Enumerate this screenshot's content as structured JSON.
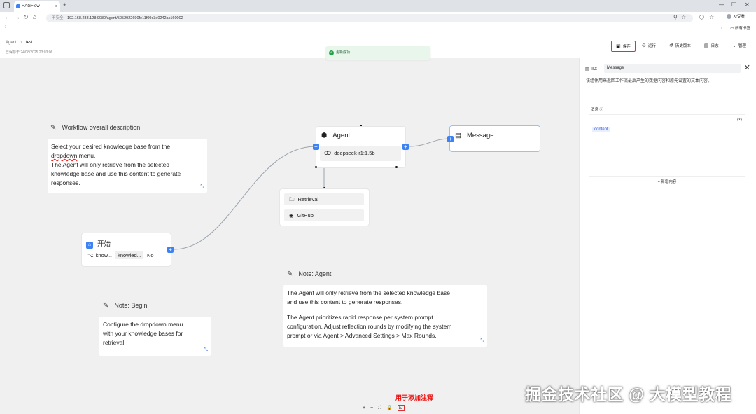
{
  "browser": {
    "tab_title": "RAGFlow",
    "tab_close": "×",
    "new_tab": "+",
    "url_insecure": "不安全",
    "url": "192.168.233.128:9080/agent/5052922690fe11f09c3e0242ac160002",
    "profile": "Xr受看",
    "bookmarks_right": "所有书签",
    "window_controls": [
      "—",
      "☐",
      "✕"
    ]
  },
  "header": {
    "breadcrumb_root": "Agent",
    "breadcrumb_current": "test",
    "saved_at": "已保存于 24/08/2025 23:03:06",
    "buttons": {
      "save": "保存",
      "run": "运行",
      "history": "历史版本",
      "log": "日志",
      "manage": "管理"
    }
  },
  "toast": {
    "text": "更新成功"
  },
  "canvas": {
    "note_workflow": {
      "title": "Workflow overall description",
      "text_squiggle": "dropdown",
      "line1": "Select your desired knowledge base from the",
      "line2_rest": " menu.",
      "line3": "The Agent will only retrieve from the selected",
      "line4": "knowledge base and use this content  to generate",
      "line5": "responses."
    },
    "note_begin": {
      "title": "Note: Begin",
      "line1": "Configure the dropdown menu",
      "line2": "with your knowledge bases for",
      "line3": "retrieval."
    },
    "note_agent": {
      "title": "Note: Agent",
      "line1": "The Agent will only retrieve from the selected knowledge base",
      "line2": "and use this content  to generate responses.",
      "line3": "The Agent prioritizes rapid response per system prompt",
      "line4": "configuration. Adjust reflection rounds by modifying the system",
      "line5": "prompt or via Agent > Advanced Settings > Max Rounds."
    },
    "node_begin": {
      "title": "开始",
      "param_name": "know...",
      "param_value": "knowled...",
      "param_flag": "No"
    },
    "node_agent": {
      "title": "Agent",
      "model": "deepseek-r1:1.5b"
    },
    "node_tools": {
      "items": [
        "Retrieval",
        "GitHub"
      ]
    },
    "node_message": {
      "title": "Message"
    }
  },
  "panel": {
    "id_label": "ID:",
    "id_value": "Message",
    "close": "✕",
    "description": "该组件用来返回工作流最后产生的数据内容和原先设置的文本内容。",
    "message_label": "消息",
    "variable": "content",
    "add_content": "新增内容"
  },
  "controls": {
    "zoom_in": "+",
    "zoom_out": "−",
    "fit": "⛶",
    "lock": "🔒",
    "add_note": "⊡"
  },
  "annotation": "用于添加注释",
  "watermark": "掘金技术社区 @ 大模型教程",
  "colors": {
    "accent": "#3b82f6",
    "highlight_red": "#dd3333",
    "toast_bg": "#e8f6ec"
  }
}
